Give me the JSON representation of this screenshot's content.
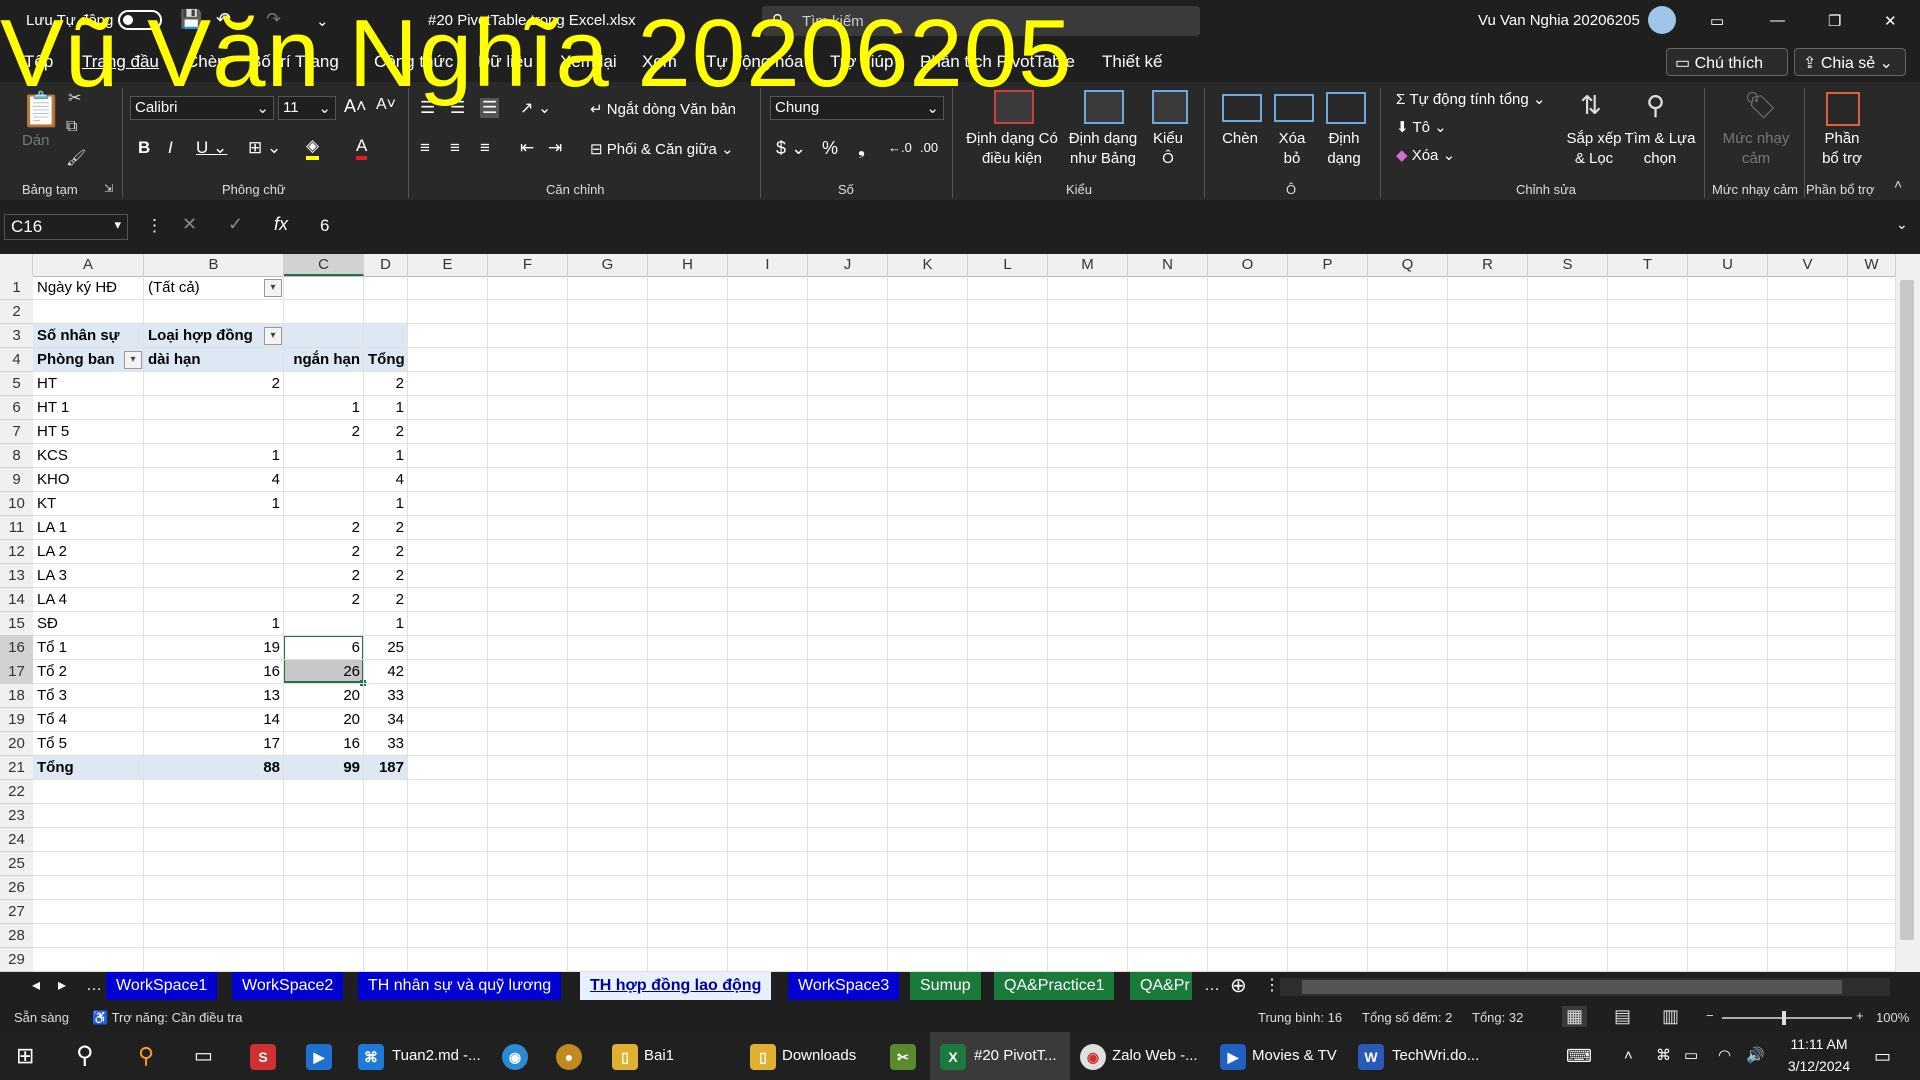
{
  "watermark": "Vũ Văn Nghĩa 20206205",
  "titlebar": {
    "autosave": "Lưu Tự động",
    "filename": "#20 PivotTable trong Excel.xlsx",
    "search_placeholder": "Tìm kiếm",
    "user": "Vu Van Nghia 20206205"
  },
  "tabs": [
    "Tệp",
    "Trang đầu",
    "Chèn",
    "Bố trí Trang",
    "Công thức",
    "Dữ liệu",
    "Xem lại",
    "Xem",
    "Tự động hóa",
    "Trợ giúp",
    "Phân tích PivotTable",
    "Thiết kế"
  ],
  "buttons": {
    "comment": "Chú thích",
    "share": "Chia sẻ"
  },
  "ribbon": {
    "clipboard": {
      "paste": "Dán",
      "label": "Bảng tạm"
    },
    "font": {
      "name": "Calibri",
      "size": "11",
      "label": "Phông chữ"
    },
    "alignment": {
      "wrap": "Ngắt dòng Văn bản",
      "merge": "Phối & Căn giữa",
      "label": "Căn chỉnh"
    },
    "number": {
      "format": "Chung",
      "label": "Số"
    },
    "styles": {
      "cond": "Định dạng Có",
      "cond2": "điều kiện",
      "table": "Định dạng",
      "table2": "như Bảng",
      "cell": "Kiểu",
      "cell2": "Ô",
      "label": "Kiểu"
    },
    "cells": {
      "insert": "Chèn",
      "delete": "Xóa",
      "delete2": "bỏ",
      "format": "Định",
      "format2": "dạng",
      "label": "Ô"
    },
    "editing": {
      "autosum": "Tự động tính tổng",
      "fill": "Tô",
      "clear": "Xóa",
      "sort": "Sắp xếp",
      "sort2": "& Lọc",
      "find": "Tìm & Lựa",
      "find2": "chọn",
      "label": "Chỉnh sửa"
    },
    "sensitivity": {
      "btn": "Mức nhạy",
      "btn2": "cảm",
      "label": "Mức nhạy cảm"
    },
    "addins": {
      "btn": "Phần",
      "btn2": "bổ trợ",
      "label": "Phần bổ trợ"
    }
  },
  "formula": {
    "namebox": "C16",
    "fx": "fx",
    "value": "6"
  },
  "columns": [
    "A",
    "B",
    "C",
    "D",
    "E",
    "F",
    "G",
    "H",
    "I",
    "J",
    "K",
    "L",
    "M",
    "N",
    "O",
    "P",
    "Q",
    "R",
    "S",
    "T",
    "U",
    "V",
    "W"
  ],
  "rows": [
    "1",
    "2",
    "3",
    "4",
    "5",
    "6",
    "7",
    "8",
    "9",
    "10",
    "11",
    "12",
    "13",
    "14",
    "15",
    "16",
    "17",
    "18",
    "19",
    "20",
    "21",
    "22",
    "23",
    "24",
    "25",
    "26",
    "27",
    "28",
    "29"
  ],
  "pivot": {
    "filter_label": "Ngày ký HĐ",
    "filter_value": "(Tất cả)",
    "values_label": "Số nhân sự",
    "col_field": "Loại hợp đồng",
    "row_field": "Phòng ban",
    "col1": "dài hạn",
    "col2": "ngắn hạn",
    "col3": "Tổng",
    "data": [
      [
        "HT",
        "2",
        "",
        "2"
      ],
      [
        "HT 1",
        "",
        "1",
        "1"
      ],
      [
        "HT 5",
        "",
        "2",
        "2"
      ],
      [
        "KCS",
        "1",
        "",
        "1"
      ],
      [
        "KHO",
        "4",
        "",
        "4"
      ],
      [
        "KT",
        "1",
        "",
        "1"
      ],
      [
        "LA 1",
        "",
        "2",
        "2"
      ],
      [
        "LA 2",
        "",
        "2",
        "2"
      ],
      [
        "LA 3",
        "",
        "2",
        "2"
      ],
      [
        "LA 4",
        "",
        "2",
        "2"
      ],
      [
        "SĐ",
        "1",
        "",
        "1"
      ],
      [
        "Tổ 1",
        "19",
        "6",
        "25"
      ],
      [
        "Tổ 2",
        "16",
        "26",
        "42"
      ],
      [
        "Tổ 3",
        "13",
        "20",
        "33"
      ],
      [
        "Tổ 4",
        "14",
        "20",
        "34"
      ],
      [
        "Tổ 5",
        "17",
        "16",
        "33"
      ]
    ],
    "total": [
      "Tổng",
      "88",
      "99",
      "187"
    ]
  },
  "sheets": [
    "WorkSpace1",
    "WorkSpace2",
    "TH nhân sự và quỹ lương",
    "TH hợp đồng lao động",
    "WorkSpace3",
    "Sumup",
    "QA&Practice1",
    "QA&Pr"
  ],
  "status": {
    "ready": "Sẵn sàng",
    "accessibility": "Trợ năng: Cần điều tra",
    "average": "Trung bình: 16",
    "count": "Tổng số đếm: 2",
    "sum": "Tổng: 32",
    "zoom": "100%"
  },
  "taskbar": {
    "apps": [
      "Tuan2.md -...",
      "Bai1",
      "Downloads",
      "#20 PivotT...",
      "Zalo Web -...",
      "Movies & TV",
      "TechWri.do..."
    ],
    "time": "11:11 AM",
    "date": "3/12/2024"
  }
}
